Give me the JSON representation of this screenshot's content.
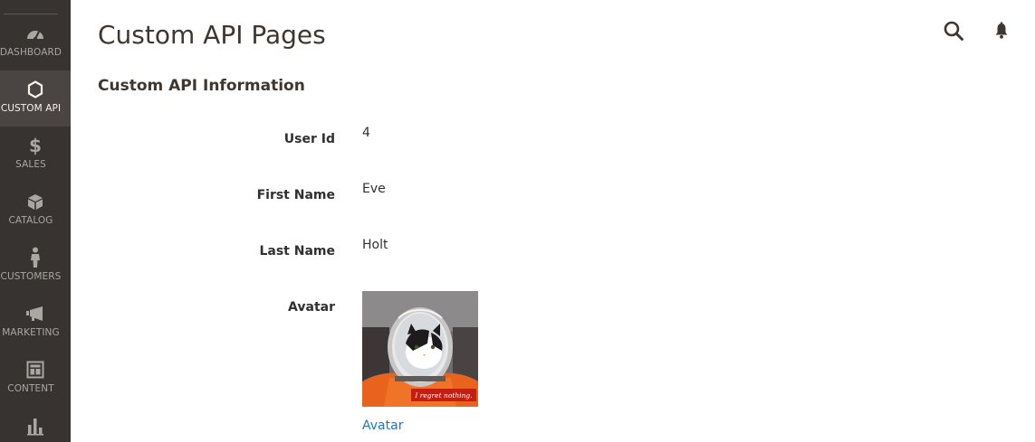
{
  "sidebar": {
    "items": [
      {
        "label": "DASHBOARD",
        "icon": "dashboard-icon",
        "active": false
      },
      {
        "label": "CUSTOM API",
        "icon": "hexagon-icon",
        "active": true
      },
      {
        "label": "SALES",
        "icon": "dollar-icon",
        "active": false
      },
      {
        "label": "CATALOG",
        "icon": "cube-icon",
        "active": false
      },
      {
        "label": "CUSTOMERS",
        "icon": "person-icon",
        "active": false
      },
      {
        "label": "MARKETING",
        "icon": "megaphone-icon",
        "active": false
      },
      {
        "label": "CONTENT",
        "icon": "layout-icon",
        "active": false
      },
      {
        "label": "",
        "icon": "bar-chart-icon",
        "active": false
      }
    ]
  },
  "header": {
    "title": "Custom API Pages",
    "actions": [
      "search-icon",
      "bell-icon"
    ]
  },
  "section": {
    "title": "Custom API Information",
    "fields": {
      "user_id": {
        "label": "User Id",
        "value": "4"
      },
      "first_name": {
        "label": "First Name",
        "value": "Eve"
      },
      "last_name": {
        "label": "Last Name",
        "value": "Holt"
      },
      "avatar": {
        "label": "Avatar",
        "link_text": "Avatar",
        "image_caption": "I regret nothing."
      }
    }
  },
  "colors": {
    "sidebar_bg": "#373330",
    "sidebar_active": "#4a4542",
    "link": "#1979c3",
    "title": "#41362f"
  }
}
